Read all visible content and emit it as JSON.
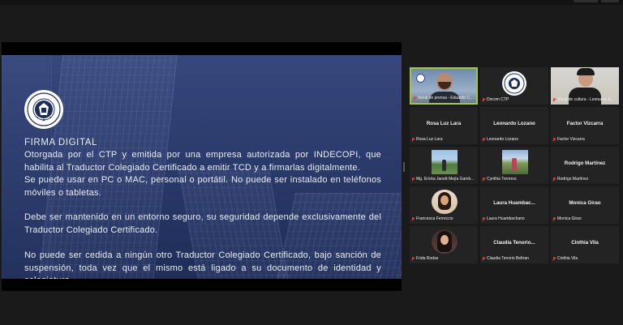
{
  "slide": {
    "title": "FIRMA DIGITAL",
    "paragraph1": "Otorgada por el CTP y emitida por una empresa autorizada por INDECOPI, que habilita al Traductor Colegiado Certificado a emitir TCD y a firmarlas digitalmente.",
    "paragraph2": "Se puede usar en PC o MAC, personal o portátil. No puede ser instalado en teléfonos móviles o tabletas.",
    "paragraph3": "Debe ser mantenido en un entorno seguro, su seguridad depende exclusivamente del Traductor Colegiado Certificado.",
    "paragraph4": "No puede ser cedida a ningún otro Traductor Colegiado Certificado, bajo sanción de suspensión, toda vez que el mismo está ligado a su documento de identidad y colegiatura."
  },
  "participants": [
    {
      "caption": "Vocal de prensa - Eduardo Cast...",
      "name": "",
      "kind": "video-man"
    },
    {
      "caption": "Dircom CTP",
      "name": "",
      "kind": "logo"
    },
    {
      "caption": "Vocal de cultura - Leonardo A...",
      "name": "",
      "kind": "video-young"
    },
    {
      "caption": "Rosa Luz Lara",
      "name": "Rosa Luz Lara",
      "kind": "name"
    },
    {
      "caption": "Leonardo Lozano",
      "name": "Leonardo Lozano",
      "kind": "name"
    },
    {
      "caption": "Factor Vizcarra",
      "name": "Factor Vizcarra",
      "kind": "name"
    },
    {
      "caption": "Mg. Ericka Janett Mejía Gamb...",
      "name": "",
      "kind": "photo-landscape"
    },
    {
      "caption": "Cynthia Torreros",
      "name": "",
      "kind": "photo-outdoor"
    },
    {
      "caption": "Rodrigo Martínez",
      "name": "Rodrigo Martínez",
      "kind": "name"
    },
    {
      "caption": "Francesca Ferreccio",
      "name": "",
      "kind": "avatar-woman"
    },
    {
      "caption": "Laura Huambachano",
      "name": "Laura Huambac...",
      "kind": "name"
    },
    {
      "caption": "Monica Girao",
      "name": "Monica Girao",
      "kind": "name"
    },
    {
      "caption": "Frida Rodas",
      "name": "",
      "kind": "avatar-woman2"
    },
    {
      "caption": "Claudia Tenorio Beltran",
      "name": "Claudia Tenorio...",
      "kind": "name"
    },
    {
      "caption": "Cinthia Vila",
      "name": "Cinthia Vila",
      "kind": "name"
    }
  ],
  "colors": {
    "active_speaker_border": "#a5c83a",
    "muted_icon": "#e2413c",
    "slide_background": "#2b3b6b"
  }
}
